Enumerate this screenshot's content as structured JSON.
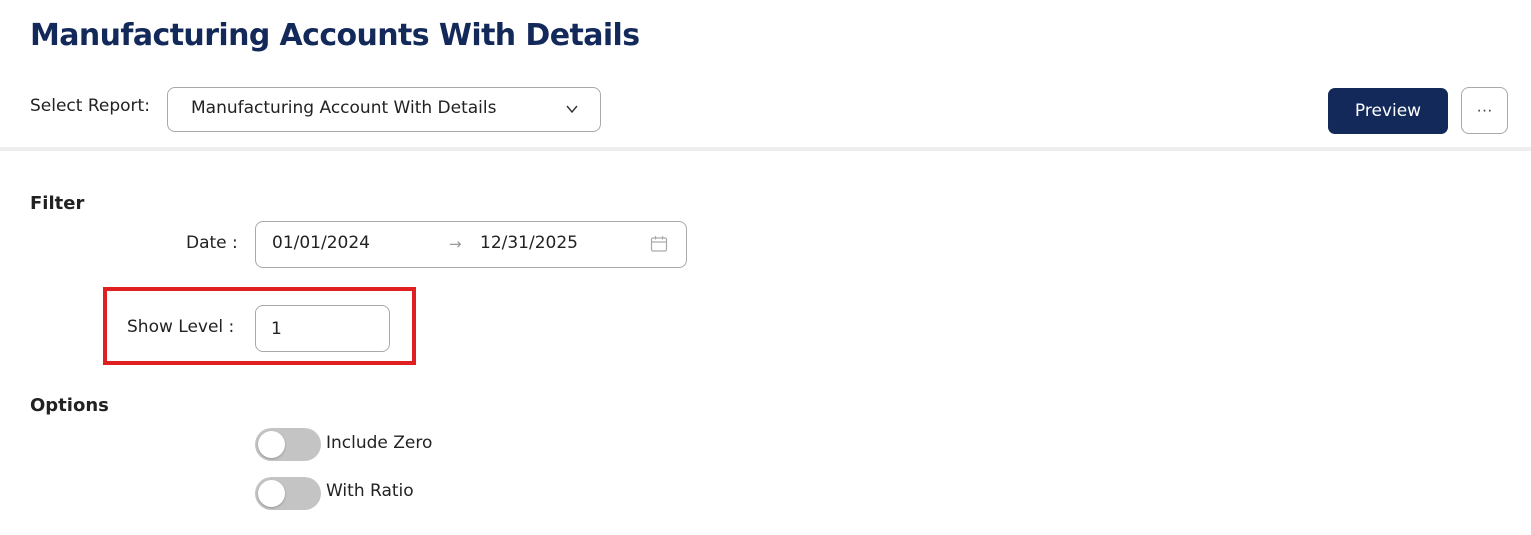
{
  "page": {
    "title": "Manufacturing Accounts With Details"
  },
  "report": {
    "label": "Select Report:",
    "selected": "Manufacturing Account With Details",
    "preview_label": "Preview",
    "more_label": "···"
  },
  "filter": {
    "title": "Filter",
    "date_label": "Date :",
    "date_from": "01/01/2024",
    "date_to": "12/31/2025",
    "date_arrow": "→",
    "level_label": "Show Level :",
    "level_value": "1"
  },
  "options": {
    "title": "Options",
    "toggles": [
      {
        "label": "Include Zero",
        "checked": false
      },
      {
        "label": "With Ratio",
        "checked": false
      }
    ]
  },
  "colors": {
    "brand": "#12295a",
    "highlight": "#e02020",
    "toggle_off": "#c4c4c4"
  }
}
